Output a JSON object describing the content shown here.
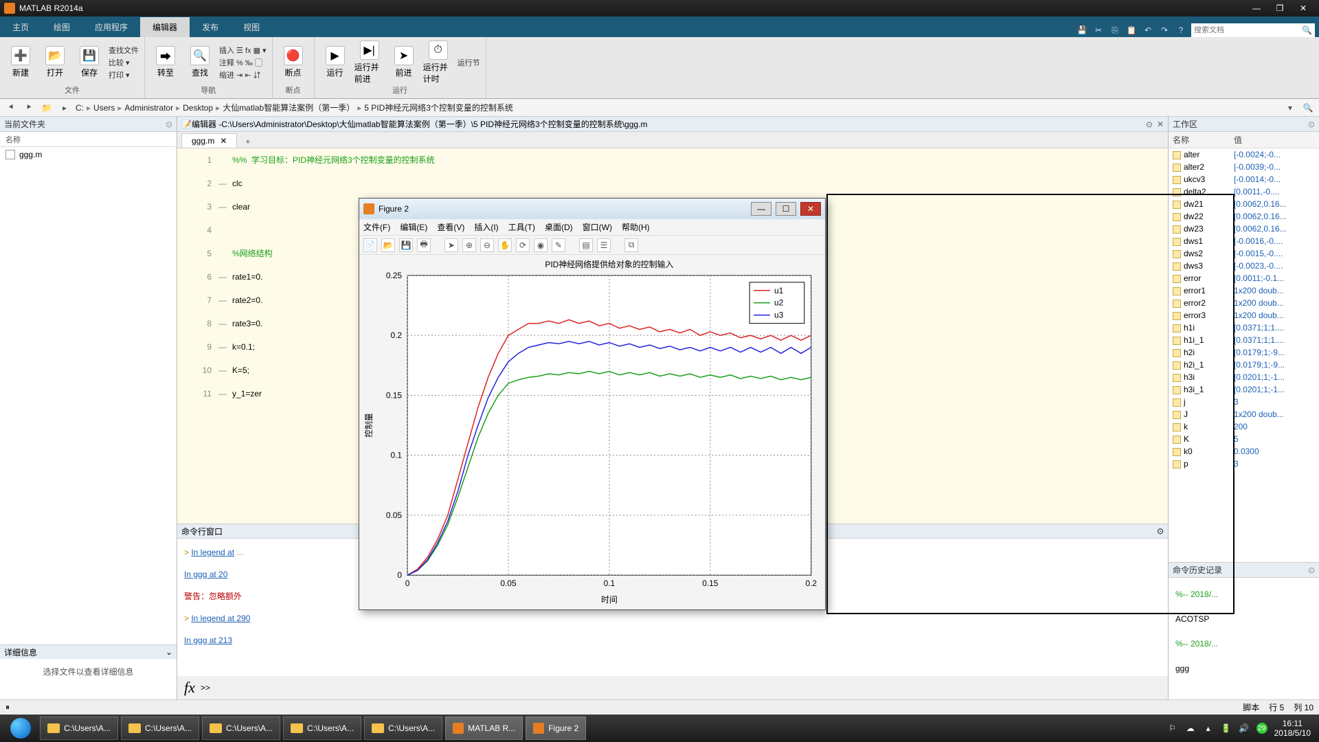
{
  "app": {
    "title": "MATLAB R2014a"
  },
  "window_controls": {
    "min": "—",
    "max": "❐",
    "close": "✕"
  },
  "tabs": {
    "items": [
      "主页",
      "绘图",
      "应用程序",
      "编辑器",
      "发布",
      "视图"
    ],
    "selected": 3,
    "search_placeholder": "搜索文档"
  },
  "ribbon": {
    "groups": [
      {
        "label": "文件",
        "big": [
          {
            "label": "新建",
            "icon": "➕"
          },
          {
            "label": "打开",
            "icon": "📂"
          },
          {
            "label": "保存",
            "icon": "💾"
          }
        ],
        "small": [
          "查找文件",
          "比较 ▾",
          "打印 ▾"
        ]
      },
      {
        "label": "导航",
        "small": [
          "插入 ☰ fx ▦ ▾",
          "注释 % ‰ ▢",
          "缩进 ⇥ ⇤ ⇵"
        ],
        "big": [
          {
            "label": "转至",
            "icon": "⮕"
          },
          {
            "label": "查找",
            "icon": "🔍"
          }
        ]
      },
      {
        "label": "断点",
        "big": [
          {
            "label": "断点",
            "icon": "🔴"
          }
        ]
      },
      {
        "label": "运行",
        "big": [
          {
            "label": "运行",
            "icon": "▶"
          },
          {
            "label": "运行并前进",
            "icon": "▶|"
          },
          {
            "label": "前进",
            "icon": "➤"
          },
          {
            "label": "运行并计时",
            "icon": "⏱"
          }
        ],
        "small": [
          "运行节"
        ]
      }
    ]
  },
  "breadcrumb": {
    "items": [
      "C:",
      "Users",
      "Administrator",
      "Desktop",
      "大仙matlab智能算法案例（第一季）",
      "5   PID神经元网络3个控制变量的控制系统"
    ]
  },
  "current_folder": {
    "title": "当前文件夹",
    "name_header": "名称",
    "files": [
      {
        "name": "ggg.m"
      }
    ]
  },
  "details": {
    "title": "详细信息",
    "body": "选择文件以查看详细信息"
  },
  "editor": {
    "title_prefix": "编辑器 - ",
    "path": "C:\\Users\\Administrator\\Desktop\\大仙matlab智能算法案例（第一季）\\5   PID神经元网络3个控制变量的控制系统\\ggg.m",
    "tab": "ggg.m",
    "lines": [
      {
        "n": 1,
        "dash": "",
        "text": "%%  学习目标：PID神经元网络3个控制变量的控制系统",
        "cls": "c-comment"
      },
      {
        "n": 2,
        "dash": "—",
        "text": "clc",
        "cls": "c-kw"
      },
      {
        "n": 3,
        "dash": "—",
        "text": "clear",
        "cls": "c-kw"
      },
      {
        "n": 4,
        "dash": "",
        "text": "",
        "cls": ""
      },
      {
        "n": 5,
        "dash": "",
        "text": "%网络结构",
        "cls": "c-comment"
      },
      {
        "n": 6,
        "dash": "—",
        "text": "rate1=0.",
        "cls": "c-kw"
      },
      {
        "n": 7,
        "dash": "—",
        "text": "rate2=0.",
        "cls": "c-kw"
      },
      {
        "n": 8,
        "dash": "—",
        "text": "rate3=0.",
        "cls": "c-kw"
      },
      {
        "n": 9,
        "dash": "—",
        "text": "k=0.1;",
        "cls": "c-kw"
      },
      {
        "n": 10,
        "dash": "—",
        "text": "K=5;",
        "cls": "c-kw"
      },
      {
        "n": 11,
        "dash": "—",
        "text": "y_1=zer",
        "cls": "c-kw"
      }
    ]
  },
  "cmdwin": {
    "title": "命令行窗口",
    "lines": [
      {
        "pre": "> ",
        "link": "In legend at",
        "rest": " ...",
        "cls": "warn"
      },
      {
        "pre": "  ",
        "link": "In ggg at 20",
        "rest": "",
        "cls": "warn"
      },
      {
        "pre": "",
        "link": "",
        "rest": "警告：忽略额外",
        "cls": "err"
      },
      {
        "pre": "> ",
        "link": "In legend at 290",
        "rest": "",
        "cls": "warn"
      },
      {
        "pre": "  ",
        "link": "In ggg at 213",
        "rest": "",
        "cls": "warn"
      }
    ],
    "prompt": ">>"
  },
  "workspace": {
    "title": "工作区",
    "name_header": "名称",
    "value_header": "值",
    "vars": [
      {
        "n": "alter",
        "v": "[-0.0024;-0..."
      },
      {
        "n": "alter2",
        "v": "[-0.0039;-0..."
      },
      {
        "n": "ukcv3",
        "v": "[-0.0014;-0..."
      },
      {
        "n": "delta2",
        "v": "[0.0011,-0...."
      },
      {
        "n": "dw21",
        "v": "[0.0062,0.16..."
      },
      {
        "n": "dw22",
        "v": "[0.0062,0.16..."
      },
      {
        "n": "dw23",
        "v": "[0.0062,0.16..."
      },
      {
        "n": "dws1",
        "v": "[-0.0016,-0...."
      },
      {
        "n": "dws2",
        "v": "[-0.0015,-0...."
      },
      {
        "n": "dws3",
        "v": "[-0.0023,-0...."
      },
      {
        "n": "error",
        "v": "[0.0011;-0.1..."
      },
      {
        "n": "error1",
        "v": "1x200 doub..."
      },
      {
        "n": "error2",
        "v": "1x200 doub..."
      },
      {
        "n": "error3",
        "v": "1x200 doub..."
      },
      {
        "n": "h1i",
        "v": "[0.0371;1;1...."
      },
      {
        "n": "h1i_1",
        "v": "[0.0371;1;1...."
      },
      {
        "n": "h2i",
        "v": "[0.0179;1;-9..."
      },
      {
        "n": "h2i_1",
        "v": "[0.0179;1;-9..."
      },
      {
        "n": "h3i",
        "v": "[0.0201;1;-1..."
      },
      {
        "n": "h3i_1",
        "v": "[0.0201;1;-1..."
      },
      {
        "n": "j",
        "v": "3"
      },
      {
        "n": "J",
        "v": "1x200 doub..."
      },
      {
        "n": "k",
        "v": "200"
      },
      {
        "n": "K",
        "v": "5"
      },
      {
        "n": "k0",
        "v": "0.0300"
      },
      {
        "n": "p",
        "v": "3"
      }
    ]
  },
  "history": {
    "title": "命令历史记录",
    "items": [
      {
        "text": "%-- 2018/...",
        "cls": "co"
      },
      {
        "text": "ACOTSP",
        "cls": ""
      },
      {
        "text": "%-- 2018/...",
        "cls": "co"
      },
      {
        "text": "ggg",
        "cls": ""
      }
    ]
  },
  "status": {
    "left": "",
    "type": "脚本",
    "line_label": "行",
    "line": "5",
    "col_label": "列",
    "col": "10"
  },
  "taskbar": {
    "items": [
      {
        "label": "C:\\Users\\A...",
        "icon": "folder"
      },
      {
        "label": "C:\\Users\\A...",
        "icon": "folder"
      },
      {
        "label": "C:\\Users\\A...",
        "icon": "folder"
      },
      {
        "label": "C:\\Users\\A...",
        "icon": "folder"
      },
      {
        "label": "C:\\Users\\A...",
        "icon": "folder"
      },
      {
        "label": "MATLAB R...",
        "icon": "matlab",
        "active": true
      },
      {
        "label": "Figure 2",
        "icon": "matlab",
        "active": true
      }
    ],
    "time": "16:11",
    "date": "2018/5/10",
    "ime": "29"
  },
  "figure": {
    "title": "Figure 2",
    "menus": [
      "文件(F)",
      "编辑(E)",
      "查看(V)",
      "插入(I)",
      "工具(T)",
      "桌面(D)",
      "窗口(W)",
      "帮助(H)"
    ],
    "chart_title": "PID神经网络提供给对象的控制输入",
    "xlabel": "时间",
    "ylabel": "控制量"
  },
  "chart_data": {
    "type": "line",
    "title": "PID神经网络提供给对象的控制输入",
    "xlabel": "时间",
    "ylabel": "控制量",
    "xlim": [
      0,
      0.2
    ],
    "ylim": [
      0,
      0.25
    ],
    "xticks": [
      0,
      0.05,
      0.1,
      0.15,
      0.2
    ],
    "yticks": [
      0,
      0.05,
      0.1,
      0.15,
      0.2,
      0.25
    ],
    "legend": [
      "u1",
      "u2",
      "u3"
    ],
    "legend_pos": "upper-right",
    "x": [
      0,
      0.005,
      0.01,
      0.015,
      0.02,
      0.025,
      0.03,
      0.035,
      0.04,
      0.045,
      0.05,
      0.055,
      0.06,
      0.065,
      0.07,
      0.075,
      0.08,
      0.085,
      0.09,
      0.095,
      0.1,
      0.105,
      0.11,
      0.115,
      0.12,
      0.125,
      0.13,
      0.135,
      0.14,
      0.145,
      0.15,
      0.155,
      0.16,
      0.165,
      0.17,
      0.175,
      0.18,
      0.185,
      0.19,
      0.195,
      0.2
    ],
    "series": [
      {
        "name": "u1",
        "color": "#d22",
        "values": [
          0,
          0.005,
          0.015,
          0.03,
          0.05,
          0.08,
          0.11,
          0.14,
          0.165,
          0.185,
          0.2,
          0.205,
          0.21,
          0.21,
          0.212,
          0.21,
          0.213,
          0.21,
          0.212,
          0.208,
          0.21,
          0.206,
          0.208,
          0.205,
          0.207,
          0.203,
          0.205,
          0.202,
          0.205,
          0.2,
          0.203,
          0.2,
          0.202,
          0.198,
          0.2,
          0.197,
          0.2,
          0.196,
          0.2,
          0.196,
          0.2
        ]
      },
      {
        "name": "u2",
        "color": "#1a9e1a",
        "values": [
          0,
          0.004,
          0.012,
          0.025,
          0.042,
          0.065,
          0.09,
          0.115,
          0.135,
          0.15,
          0.16,
          0.163,
          0.165,
          0.166,
          0.168,
          0.167,
          0.169,
          0.168,
          0.17,
          0.168,
          0.17,
          0.167,
          0.169,
          0.167,
          0.169,
          0.166,
          0.168,
          0.166,
          0.168,
          0.165,
          0.167,
          0.165,
          0.167,
          0.164,
          0.166,
          0.164,
          0.166,
          0.163,
          0.165,
          0.163,
          0.165
        ]
      },
      {
        "name": "u3",
        "color": "#22d",
        "values": [
          0,
          0.004,
          0.013,
          0.027,
          0.045,
          0.07,
          0.1,
          0.125,
          0.148,
          0.165,
          0.178,
          0.185,
          0.19,
          0.192,
          0.194,
          0.193,
          0.195,
          0.193,
          0.195,
          0.192,
          0.194,
          0.191,
          0.193,
          0.19,
          0.192,
          0.189,
          0.191,
          0.188,
          0.19,
          0.187,
          0.19,
          0.187,
          0.19,
          0.186,
          0.19,
          0.186,
          0.19,
          0.185,
          0.19,
          0.185,
          0.19
        ]
      }
    ]
  }
}
